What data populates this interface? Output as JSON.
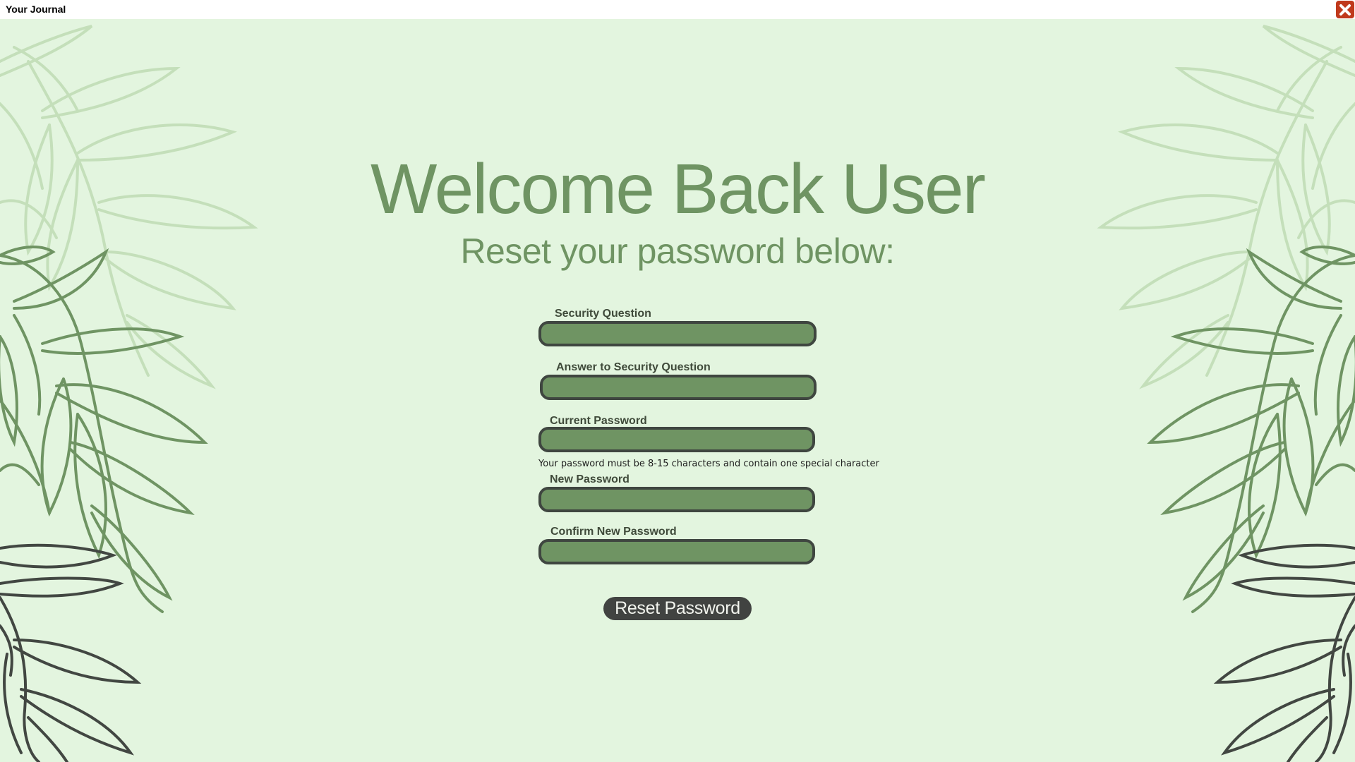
{
  "window": {
    "title": "Your Journal",
    "close_icon": "close-icon",
    "close_color": "#c0391c"
  },
  "heading": {
    "title": "Welcome Back User",
    "subtitle": "Reset your password below:"
  },
  "form": {
    "security_question_label": "Security Question",
    "security_question_value": "",
    "answer_label": "Answer to Security Question",
    "answer_value": "",
    "current_password_label": "Current Password",
    "current_password_value": "",
    "password_hint": "Your password must be 8-15 characters and contain one special character",
    "new_password_label": "New Password",
    "new_password_value": "",
    "confirm_password_label": "Confirm New Password",
    "confirm_password_value": "",
    "submit_label": "Reset Password"
  },
  "colors": {
    "background": "#e3f5df",
    "accent_green": "#6f9463",
    "input_border": "#3f4640",
    "button_bg": "#414341"
  }
}
